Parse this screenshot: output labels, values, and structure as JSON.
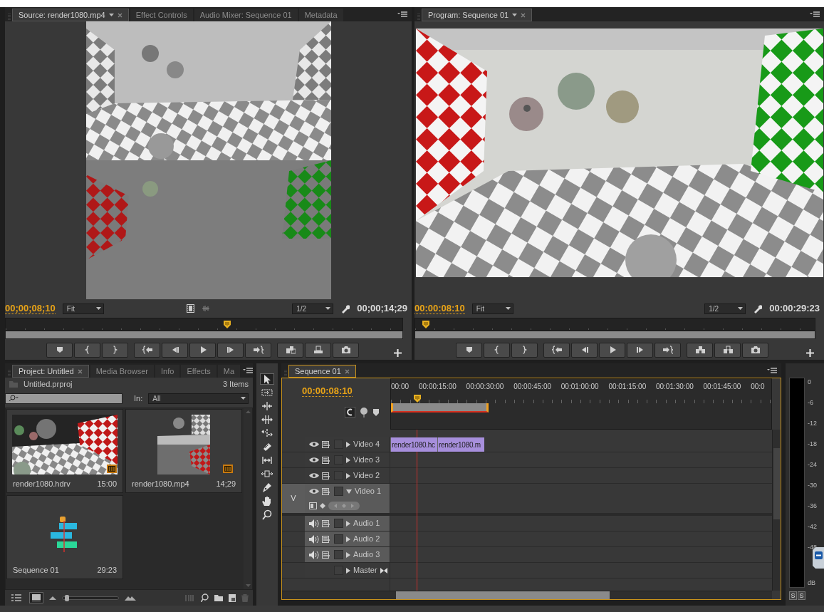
{
  "source_monitor": {
    "tabs": [
      {
        "label": "Source: render1080.mp4",
        "selected": true
      },
      {
        "label": "Effect Controls",
        "selected": false
      },
      {
        "label": "Audio Mixer: Sequence 01",
        "selected": false
      },
      {
        "label": "Metadata",
        "selected": false
      }
    ],
    "view_toggles": true,
    "current_time": "00;00;08;10",
    "zoom": "Fit",
    "resolution": "1/2",
    "duration": "00;00;14;29",
    "playhead": {
      "level": 0.56
    },
    "edit_group": {
      "kind": "insert"
    }
  },
  "program_monitor": {
    "tabs": [
      {
        "label": "Program: Sequence 01",
        "selected": true
      }
    ],
    "current_time": "00:00:08:10",
    "zoom": "Fit",
    "resolution": "1/2",
    "duration": "00:00:29:23",
    "playhead": {
      "level": 0.02
    },
    "edit_group": {
      "kind": "lift"
    }
  },
  "project": {
    "tabs": [
      {
        "label": "Project: Untitled",
        "selected": true
      },
      {
        "label": "Media Browser",
        "selected": false
      },
      {
        "label": "Info",
        "selected": false
      },
      {
        "label": "Effects",
        "selected": false
      },
      {
        "label": "Ma",
        "selected": false
      }
    ],
    "file": "Untitled.prproj",
    "item_count": "3 Items",
    "filter_label": "In:",
    "filter_value": "All",
    "items": [
      {
        "name": "render1080.hdrv",
        "duration": "15:00",
        "kind": "clip"
      },
      {
        "name": "render1080.mp4",
        "duration": "14;29",
        "kind": "clip"
      },
      {
        "name": "Sequence 01",
        "duration": "29:23",
        "kind": "sequence"
      }
    ],
    "views": [
      {
        "kind": "list",
        "selected": false
      },
      {
        "kind": "icon",
        "selected": true
      }
    ],
    "zoom_slider": {
      "level": 0.04
    }
  },
  "tools": [
    {
      "kind": "selection",
      "selected": true
    },
    {
      "kind": "track_select",
      "selected": false
    },
    {
      "kind": "ripple",
      "selected": false
    },
    {
      "kind": "rolling",
      "selected": false
    },
    {
      "kind": "rate",
      "selected": false
    },
    {
      "kind": "razor",
      "selected": false
    },
    {
      "kind": "slip",
      "selected": false
    },
    {
      "kind": "slide",
      "selected": false
    },
    {
      "kind": "pen",
      "selected": false
    },
    {
      "kind": "hand",
      "selected": false
    },
    {
      "kind": "zoom",
      "selected": false
    }
  ],
  "timeline": {
    "tab": "Sequence 01",
    "current_time": "00:00:08:10",
    "ruler": [
      "00:00",
      "00:00:15:00",
      "00:00:30:00",
      "00:00:45:00",
      "00:01:00:00",
      "00:01:15:00",
      "00:01:30:00",
      "00:01:45:00",
      "00:0"
    ],
    "playhead": {
      "level": 0.069
    },
    "work_area": {
      "level": 0.257
    },
    "tracks": [
      {
        "name": "Video 4",
        "kind": "video",
        "expanded": false,
        "targeted": false,
        "clips": [
          "render1080.hc",
          "render1080.m"
        ]
      },
      {
        "name": "Video 3",
        "kind": "video",
        "expanded": false,
        "targeted": false
      },
      {
        "name": "Video 2",
        "kind": "video",
        "expanded": false,
        "targeted": false
      },
      {
        "name": "Video 1",
        "kind": "video",
        "expanded": true,
        "targeted": true,
        "source_patch": "V"
      },
      {
        "name": "Audio 1",
        "kind": "audio",
        "expanded": false,
        "targeted": true
      },
      {
        "name": "Audio 2",
        "kind": "audio",
        "expanded": false,
        "targeted": true
      },
      {
        "name": "Audio 3",
        "kind": "audio",
        "expanded": false,
        "targeted": true
      },
      {
        "name": "Master",
        "kind": "master",
        "expanded": false,
        "targeted": false
      }
    ]
  },
  "audio_meter": {
    "scale": [
      "0",
      "-6",
      "-12",
      "-18",
      "-24",
      "-30",
      "-36",
      "-42",
      "-48"
    ],
    "unit": "dB",
    "solo_buttons": [
      "S",
      "S"
    ]
  }
}
